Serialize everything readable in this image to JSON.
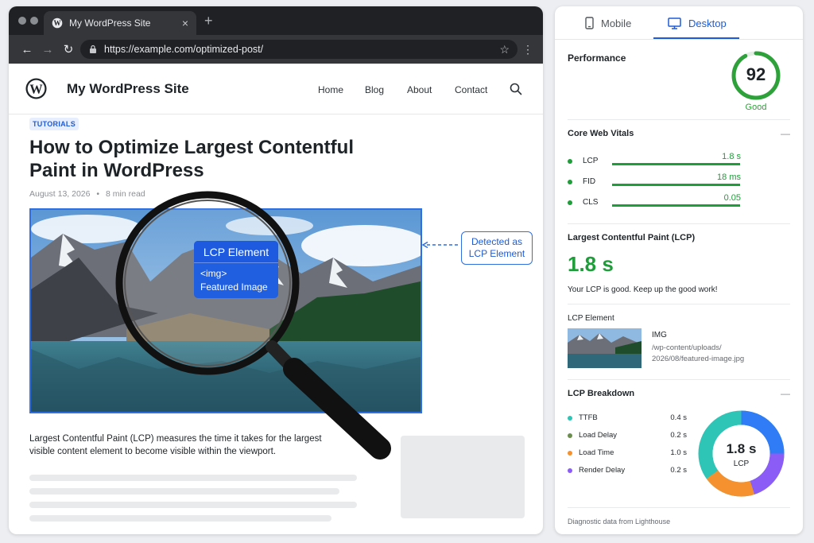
{
  "browser": {
    "tab_title": "My WordPress Site",
    "tab_close": "×",
    "new_tab": "+",
    "url": "https://example.com/optimized-post/",
    "star": "☆",
    "menu_dots": "⋮",
    "nav": {
      "back": "←",
      "forward": "→",
      "reload": "↻"
    }
  },
  "site": {
    "title": "My WordPress Site",
    "menu": [
      "Home",
      "Blog",
      "About",
      "Contact"
    ]
  },
  "post": {
    "category": "TUTORIALS",
    "title": "How to Optimize Largest Contentful Paint in WordPress",
    "date": "August 13, 2026",
    "meta_sep": "•",
    "read_time": "8 min read",
    "description": "Largest Contentful Paint (LCP) measures the time it takes for the largest visible content element to become visible within the viewport."
  },
  "lcp_badge": {
    "title": "LCP Element",
    "tag": "<img>",
    "label": "Featured Image"
  },
  "detected_label": {
    "line1": "Detected as",
    "line2": "LCP Element"
  },
  "panel": {
    "tabs": [
      {
        "label": "Mobile",
        "icon": "mobile-icon",
        "active": false
      },
      {
        "label": "Desktop",
        "icon": "desktop-icon",
        "active": true
      }
    ],
    "performance": {
      "title": "Performance",
      "score": "92",
      "score_value": 92,
      "score_label": "Good"
    },
    "core_web_vitals": {
      "title": "Core Web Vitals",
      "collapse": "—",
      "items": [
        {
          "name": "LCP",
          "value": "1.8 s"
        },
        {
          "name": "FID",
          "value": "18 ms"
        },
        {
          "name": "CLS",
          "value": "0.05"
        }
      ]
    },
    "lcp_section": {
      "title": "Largest Contentful Paint (LCP)",
      "value": "1.8 s",
      "message": "Your LCP is good. Keep up the good work!"
    },
    "lcp_element": {
      "title": "LCP Element",
      "tag": "IMG",
      "path": "/wp-content/uploads/ 2026/08/featured-image.jpg"
    },
    "breakdown": {
      "title": "LCP Breakdown",
      "collapse": "—",
      "items": [
        {
          "name": "TTFB",
          "value": "0.4 s",
          "color": "#2ec4b6"
        },
        {
          "name": "Load Delay",
          "value": "0.2 s",
          "color": "#6b8e4e"
        },
        {
          "name": "Load Time",
          "value": "1.0 s",
          "color": "#f5922f"
        },
        {
          "name": "Render Delay",
          "value": "0.2 s",
          "color": "#8b5cf6"
        }
      ],
      "center_value": "1.8 s",
      "center_label": "LCP"
    },
    "footer": "Diagnostic data from Lighthouse"
  },
  "colors": {
    "accent": "#1e5bd8",
    "good": "#1f9d3a",
    "donut": [
      "#2ec4b6",
      "#2f7cf6",
      "#8b5cf6",
      "#f5922f"
    ]
  }
}
